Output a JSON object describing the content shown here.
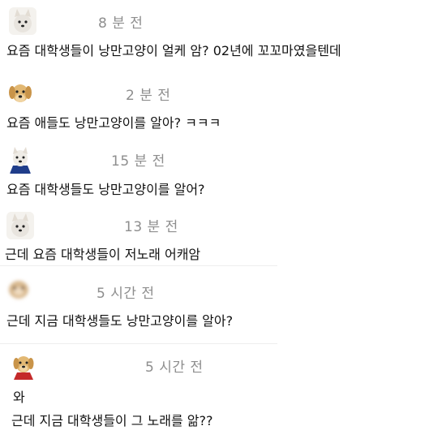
{
  "comments": [
    {
      "avatar": "white-dog-icon",
      "time": "8 분 전",
      "lines": [
        "요즘 대학생들이 낭만고양이 얼케 암? 02년에 꼬꼬마였을텐데"
      ]
    },
    {
      "avatar": "golden-puppy-icon",
      "time": "2 분 전",
      "lines": [
        "요즘 애들도 낭만고양이를 알아? ㅋㅋㅋ"
      ]
    },
    {
      "avatar": "white-dog-blue-shirt-icon",
      "time": "15 분 전",
      "lines": [
        "요즘 대학생들도 낭만고양이를 알어?"
      ]
    },
    {
      "avatar": "white-dog-icon",
      "time": "13 분 전",
      "lines": [
        "근데 요즘 대학생들이 저노래 어캐암"
      ]
    },
    {
      "avatar": "blurred-dog-icon",
      "time": "5 시간 전",
      "lines": [
        "근데 지금 대학생들도 낭만고양이를 알아?"
      ]
    },
    {
      "avatar": "puppy-red-shirt-icon",
      "time": "5 시간 전",
      "lines": [
        "와",
        "근데 지금 대학생들이 그 노래를 앎??"
      ]
    }
  ]
}
